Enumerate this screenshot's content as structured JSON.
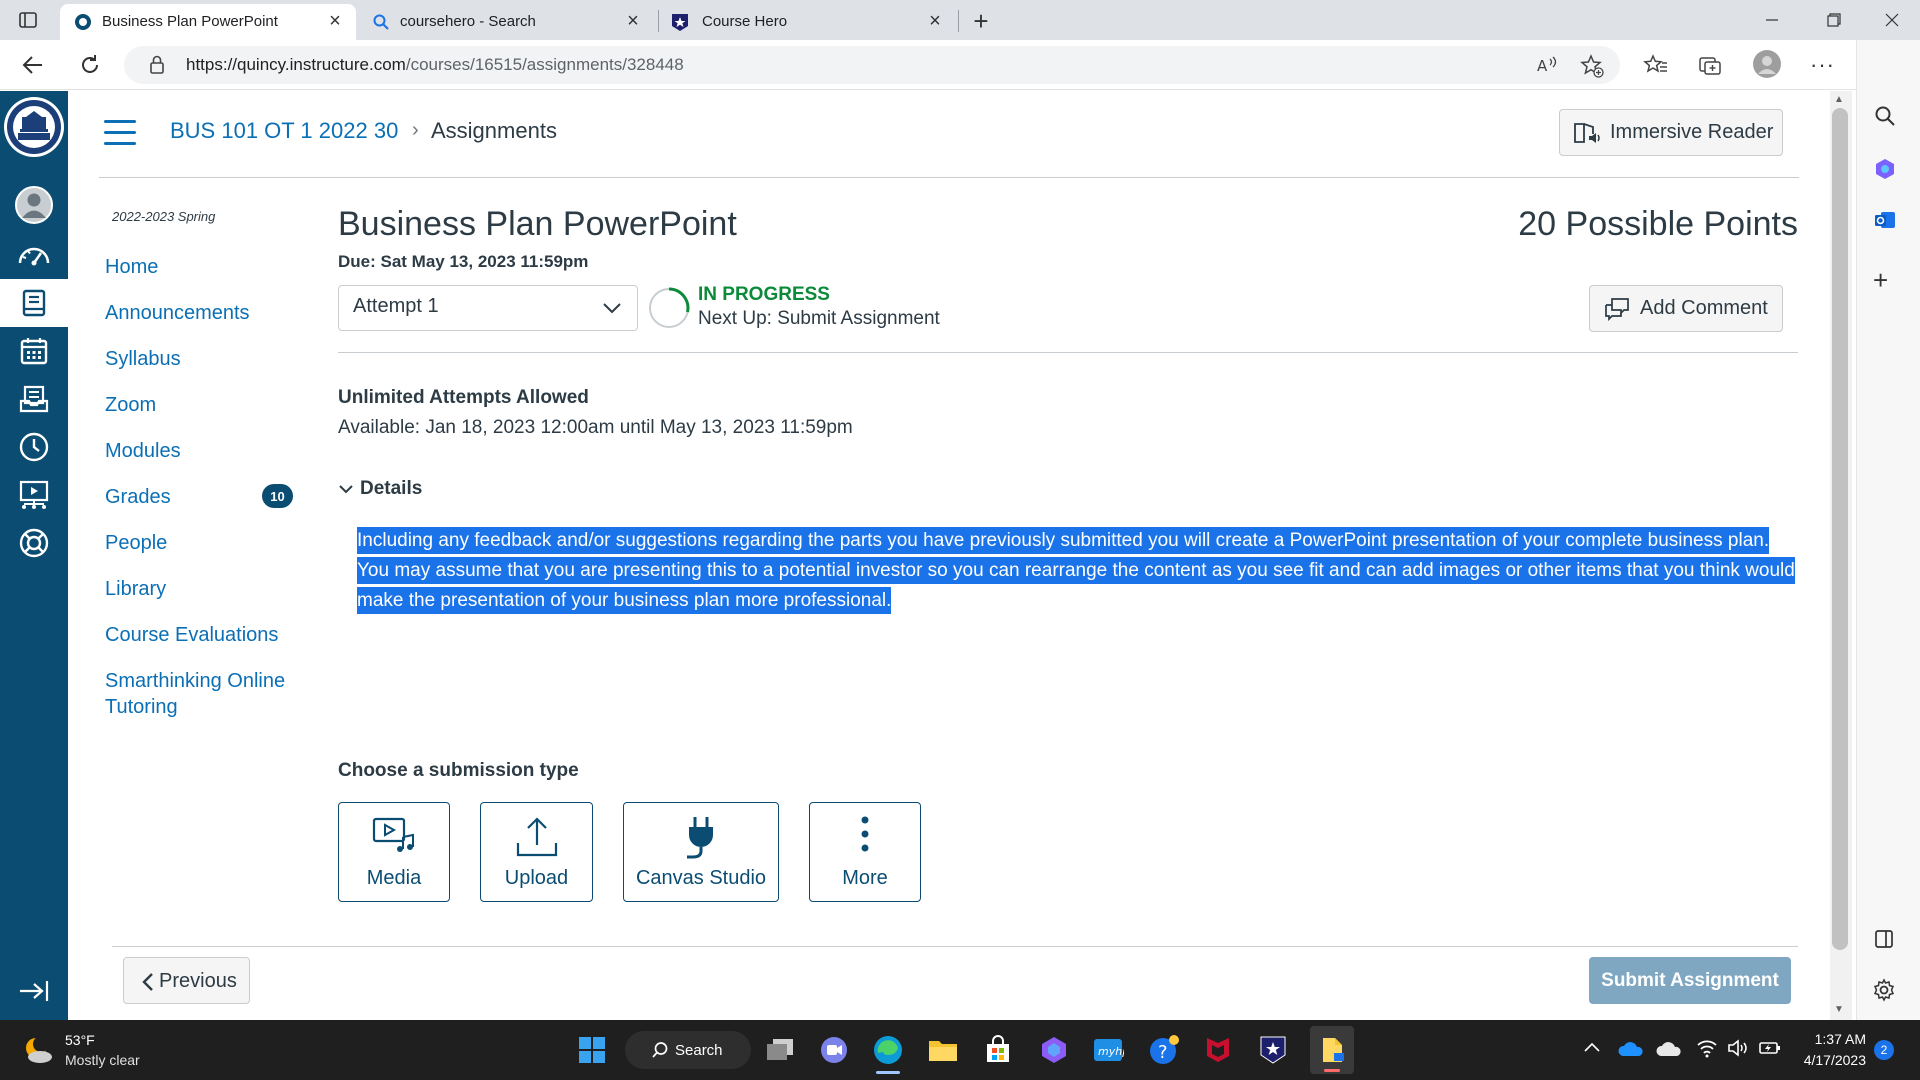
{
  "browser": {
    "tabs": [
      {
        "title": "Business Plan PowerPoint"
      },
      {
        "title": "coursehero - Search"
      },
      {
        "title": "Course Hero"
      }
    ],
    "url_host": "https://quincy.instructure.com",
    "url_path": "/courses/16515/assignments/328448"
  },
  "header": {
    "course": "BUS 101 OT 1 2022 30",
    "separator": "›",
    "current": "Assignments",
    "immersive_reader": "Immersive Reader"
  },
  "course_nav": {
    "term": "2022-2023 Spring",
    "items": [
      {
        "label": "Home"
      },
      {
        "label": "Announcements"
      },
      {
        "label": "Syllabus"
      },
      {
        "label": "Zoom"
      },
      {
        "label": "Modules"
      },
      {
        "label": "Grades",
        "badge": "10"
      },
      {
        "label": "People"
      },
      {
        "label": "Library"
      },
      {
        "label": "Course Evaluations"
      },
      {
        "label": "Smarthinking Online"
      },
      {
        "label": "Tutoring"
      }
    ]
  },
  "assignment": {
    "title": "Business Plan PowerPoint",
    "due": "Due: Sat May 13, 2023 11:59pm",
    "points": "20 Possible Points",
    "attempt": "Attempt 1",
    "status": "IN PROGRESS",
    "next_up": "Next Up: Submit Assignment",
    "add_comment": "Add Comment",
    "attempts_allowed": "Unlimited Attempts Allowed",
    "available": "Available: Jan 18, 2023 12:00am until May 13, 2023 11:59pm",
    "details_label": "Details",
    "description": "Including any feedback and/or suggestions regarding the parts you have previously submitted you will create a PowerPoint presentation of your complete business plan. You may assume that you are presenting this to a potential investor so you can rearrange the content as you see fit and can add images or other items that you think would make the presentation of your business plan more professional.",
    "submission_label": "Choose a submission type",
    "submission_types": [
      {
        "label": "Media"
      },
      {
        "label": "Upload"
      },
      {
        "label": "Canvas Studio"
      },
      {
        "label": "More"
      }
    ],
    "previous": "Previous",
    "submit": "Submit Assignment"
  },
  "taskbar": {
    "temperature": "53°F",
    "weather": "Mostly clear",
    "search": "Search",
    "time": "1:37 AM",
    "date": "4/17/2023",
    "notifications": "2"
  },
  "colors": {
    "canvas_nav": "#0b4d72",
    "link": "#0b6fb5",
    "status_green": "#0b8a3a",
    "selection": "#1a73e8"
  }
}
